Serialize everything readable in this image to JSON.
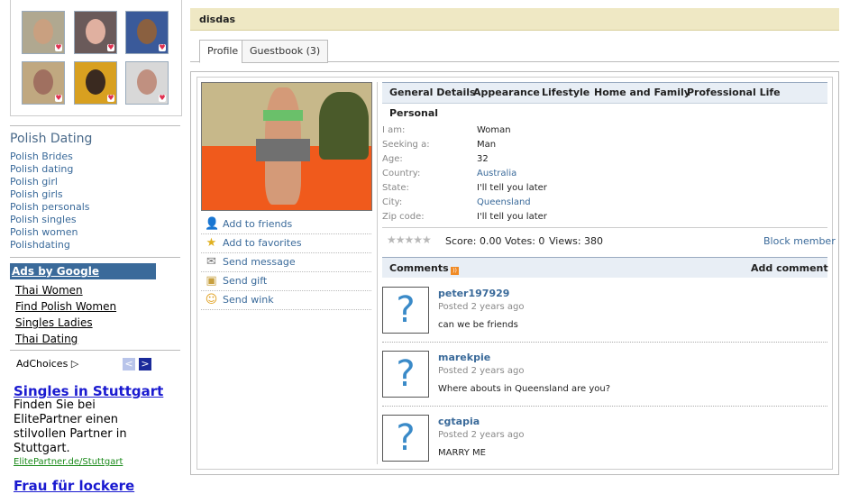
{
  "profile_name": "disdas",
  "tabs": [
    {
      "label": "Profile",
      "active": true
    },
    {
      "label": "Guestbook (3)",
      "active": false
    }
  ],
  "sidebar": {
    "polish_dating_title": "Polish Dating",
    "polish_links": [
      "Polish Brides",
      "Polish dating",
      "Polish girl",
      "Polish girls",
      "Polish personals",
      "Polish singles",
      "Polish women",
      "Polishdating"
    ],
    "ads_by_google": "Ads by Google",
    "ad_links": [
      "Thai Women",
      "Find Polish Women",
      "Singles Ladies",
      "Thai Dating"
    ],
    "adchoices": "AdChoices",
    "ad1": {
      "title": "Singles in Stuttgart",
      "body": "Finden Sie bei ElitePartner einen stilvollen Partner in Stuttgart.",
      "url": "ElitePartner.de/Stuttgart"
    },
    "ad2_title": "Frau für lockere"
  },
  "actions": [
    {
      "label": "Add to friends",
      "icon": "user-icon"
    },
    {
      "label": "Add to favorites",
      "icon": "star-icon"
    },
    {
      "label": "Send message",
      "icon": "envelope-icon"
    },
    {
      "label": "Send gift",
      "icon": "gift-icon"
    },
    {
      "label": "Send wink",
      "icon": "smiley-icon"
    }
  ],
  "detail_tabs": [
    "General Details",
    "Appearance",
    "Lifestyle",
    "Home and Family",
    "Professional Life"
  ],
  "personal": {
    "heading": "Personal",
    "rows": [
      {
        "label": "I am:",
        "value": "Woman"
      },
      {
        "label": "Seeking a:",
        "value": "Man"
      },
      {
        "label": "Age:",
        "value": "32"
      },
      {
        "label": "Country:",
        "value": "Australia"
      },
      {
        "label": "State:",
        "value": "I'll tell you later"
      },
      {
        "label": "City:",
        "value": "Queensland"
      },
      {
        "label": "Zip code:",
        "value": "I'll tell you later"
      }
    ]
  },
  "rating": {
    "score_text": "Score: 0.00 Votes: 0",
    "views_text": "Views: 380",
    "block_member": "Block member",
    "stars": "★★★★★"
  },
  "comments": {
    "title": "Comments",
    "add_comment": "Add comment",
    "items": [
      {
        "user": "peter197929",
        "posted": "Posted 2 years ago",
        "text": "can we be friends"
      },
      {
        "user": "marekpie",
        "posted": "Posted 2 years ago",
        "text": "Where abouts in Queensland are you?"
      },
      {
        "user": "cgtapia",
        "posted": "Posted 2 years ago",
        "text": "MARRY ME"
      }
    ]
  },
  "colors": {
    "name_bar": "#efe8c4",
    "link": "#3a6a9a",
    "ads_header": "#3a6a9a",
    "ad_title": "#1a1ad0",
    "ad_url": "#1a8a1a"
  }
}
